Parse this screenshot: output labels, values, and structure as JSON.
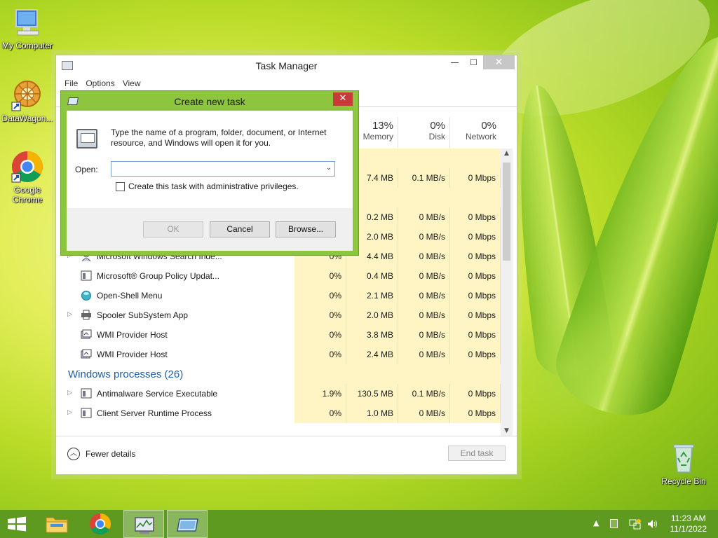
{
  "desktop": {
    "icons": [
      {
        "label": "My Computer"
      },
      {
        "label": "DataWagon..."
      },
      {
        "label": "Google Chrome"
      },
      {
        "label": "Recycle Bin"
      }
    ]
  },
  "task_manager": {
    "title": "Task Manager",
    "window_controls": {
      "minimize": "—",
      "maximize": "☐",
      "close": "✕"
    },
    "menu": [
      "File",
      "Options",
      "View"
    ],
    "columns": [
      {
        "percent": "13%",
        "label": "Memory"
      },
      {
        "percent": "0%",
        "label": "Disk"
      },
      {
        "percent": "0%",
        "label": "Network"
      }
    ],
    "hidden_rows": [
      {
        "memory": "7.4 MB",
        "disk": "0.1 MB/s",
        "network": "0 Mbps"
      },
      {
        "memory": "0.2 MB",
        "disk": "0 MB/s",
        "network": "0 Mbps"
      },
      {
        "memory": "2.0 MB",
        "disk": "0 MB/s",
        "network": "0 Mbps"
      }
    ],
    "processes": [
      {
        "name": "Microsoft Windows Search Inde...",
        "expand": true,
        "cpu": "0%",
        "memory": "4.4 MB",
        "disk": "0 MB/s",
        "network": "0 Mbps"
      },
      {
        "name": "Microsoft® Group Policy Updat...",
        "expand": false,
        "cpu": "0%",
        "memory": "0.4 MB",
        "disk": "0 MB/s",
        "network": "0 Mbps"
      },
      {
        "name": "Open-Shell Menu",
        "expand": false,
        "cpu": "0%",
        "memory": "2.1 MB",
        "disk": "0 MB/s",
        "network": "0 Mbps"
      },
      {
        "name": "Spooler SubSystem App",
        "expand": true,
        "cpu": "0%",
        "memory": "2.0 MB",
        "disk": "0 MB/s",
        "network": "0 Mbps"
      },
      {
        "name": "WMI Provider Host",
        "expand": false,
        "cpu": "0%",
        "memory": "3.8 MB",
        "disk": "0 MB/s",
        "network": "0 Mbps"
      },
      {
        "name": "WMI Provider Host",
        "expand": false,
        "cpu": "0%",
        "memory": "2.4 MB",
        "disk": "0 MB/s",
        "network": "0 Mbps"
      }
    ],
    "group_label": "Windows processes (26)",
    "windows_processes": [
      {
        "name": "Antimalware Service Executable",
        "expand": true,
        "cpu": "1.9%",
        "memory": "130.5 MB",
        "disk": "0.1 MB/s",
        "network": "0 Mbps"
      },
      {
        "name": "Client Server Runtime Process",
        "expand": true,
        "cpu": "0%",
        "memory": "1.0 MB",
        "disk": "0 MB/s",
        "network": "0 Mbps"
      }
    ],
    "footer": {
      "fewer_details": "Fewer details",
      "end_task": "End task"
    }
  },
  "dialog": {
    "title": "Create new task",
    "close": "✕",
    "description": "Type the name of a program, folder, document, or Internet resource, and Windows will open it for you.",
    "open_label": "Open:",
    "open_value": "",
    "admin_checkbox_label": "Create this task with administrative privileges.",
    "admin_checked": false,
    "buttons": {
      "ok": "OK",
      "cancel": "Cancel",
      "browse": "Browse..."
    }
  },
  "taskbar": {
    "clock_time": "11:23 AM",
    "clock_date": "11/1/2022"
  },
  "colors": {
    "dialog_frame": "#8dc53e",
    "highlight_cells": "#fff4c4",
    "group_label": "#1e5fa8",
    "taskbar": "#5e9a1f",
    "close_button": "#c83b3b"
  }
}
